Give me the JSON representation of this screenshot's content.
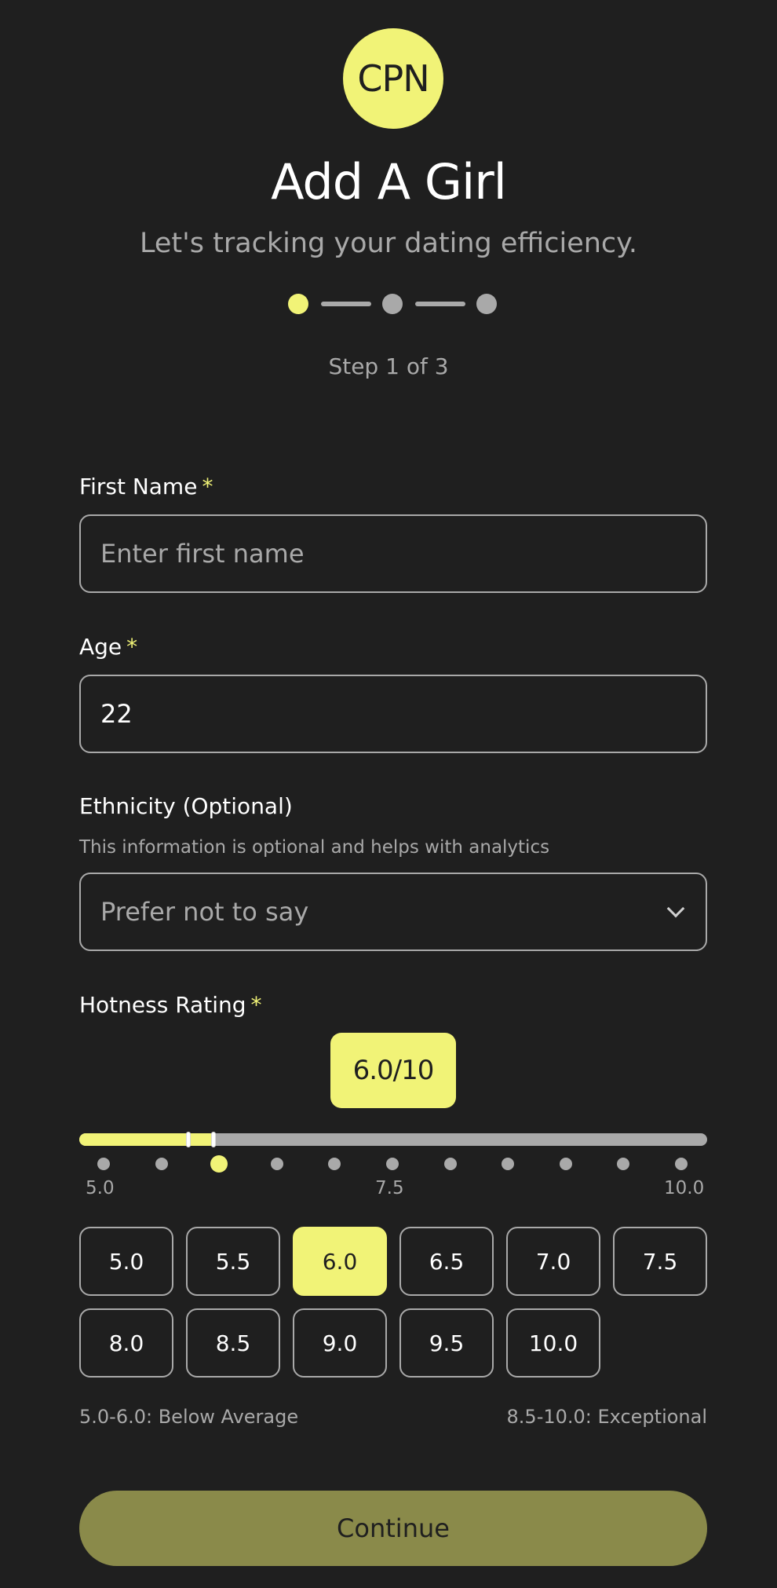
{
  "logo": {
    "text": "CPN"
  },
  "header": {
    "title": "Add A Girl",
    "subtitle": "Let's tracking your dating efficiency.",
    "step_text": "Step 1 of 3",
    "current_step": 1,
    "total_steps": 3
  },
  "form": {
    "first_name": {
      "label": "First Name",
      "required_mark": "*",
      "placeholder": "Enter first name",
      "value": ""
    },
    "age": {
      "label": "Age",
      "required_mark": "*",
      "value": "22"
    },
    "ethnicity": {
      "label": "Ethnicity (Optional)",
      "helper": "This information is optional and helps with analytics",
      "selected": "Prefer not to say"
    },
    "hotness": {
      "label": "Hotness Rating",
      "required_mark": "*",
      "value_display": "6.0/10",
      "value": 6.0,
      "min": 5.0,
      "max": 10.0,
      "scale_labels": [
        "5.0",
        "7.5",
        "10.0"
      ],
      "options": [
        "5.0",
        "5.5",
        "6.0",
        "6.5",
        "7.0",
        "7.5",
        "8.0",
        "8.5",
        "9.0",
        "9.5",
        "10.0"
      ],
      "selected_index": 2,
      "legend_low": "5.0-6.0: Below Average",
      "legend_high": "8.5-10.0: Exceptional"
    }
  },
  "continue_label": "Continue",
  "colors": {
    "background": "#1f1f1f",
    "accent": "#f1f377",
    "muted": "#a9a9a9",
    "button_disabled": "#8a8a4a"
  }
}
